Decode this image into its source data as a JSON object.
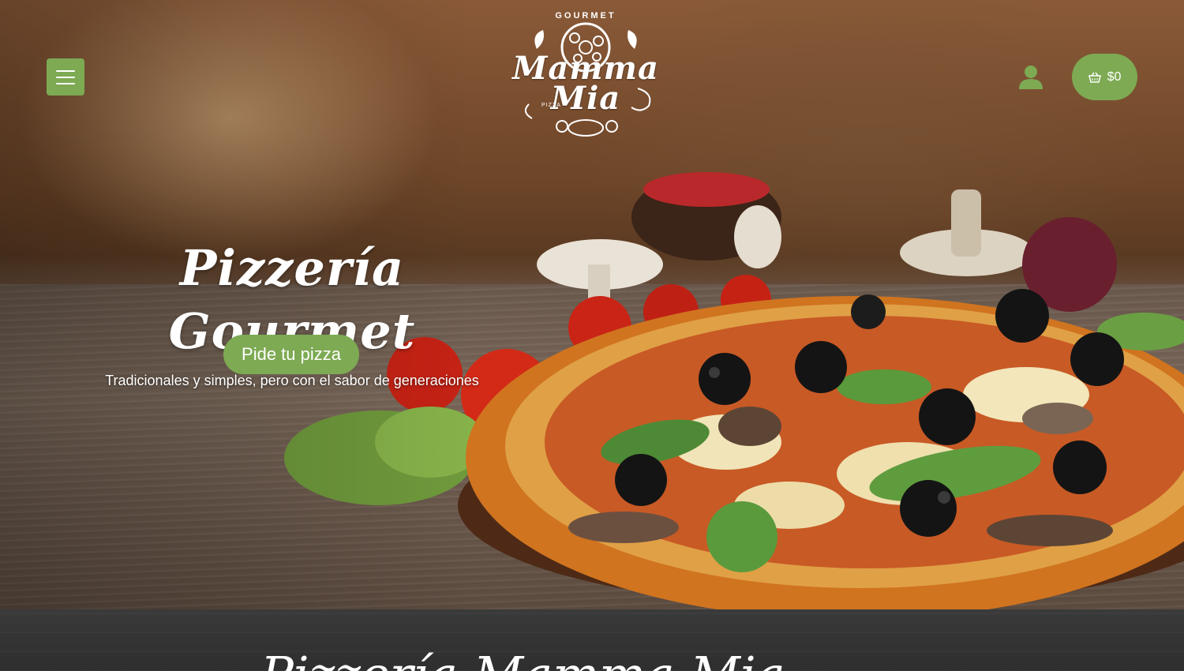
{
  "header": {
    "menu_icon": "hamburger-icon",
    "logo": {
      "top_text": "GOURMET",
      "name": "Mamma Mia",
      "small_text": "PIZZA"
    },
    "user_icon": "user-icon",
    "cart": {
      "icon": "basket-icon",
      "total": "$0"
    }
  },
  "hero": {
    "title": "Pizzería Gourmet",
    "subtitle": "Tradicionales y simples, pero con el sabor de generaciones",
    "cta_label": "Pide tu pizza"
  },
  "section": {
    "title_partial": "Pizzería Mamma Mia"
  },
  "colors": {
    "accent": "#7daa53",
    "band": "#2e2e2e",
    "text": "#ffffff"
  }
}
